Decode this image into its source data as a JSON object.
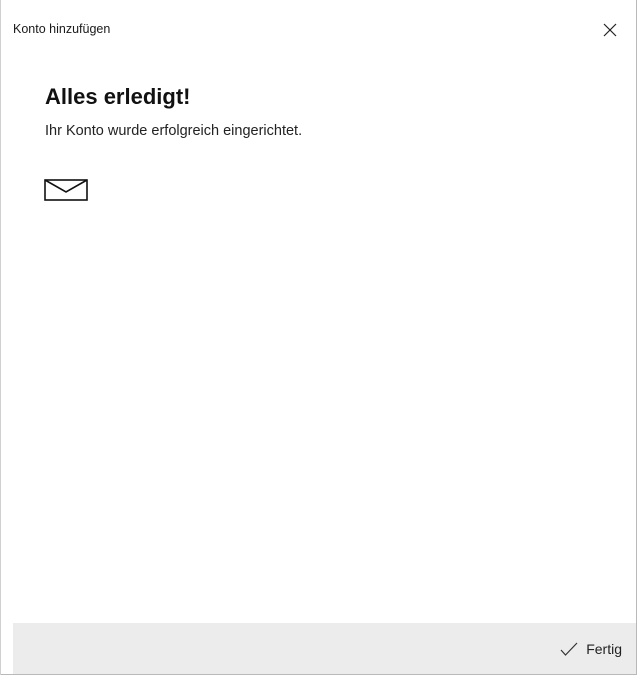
{
  "window": {
    "title": "Konto hinzufügen"
  },
  "main": {
    "heading": "Alles erledigt!",
    "message": "Ihr Konto wurde erfolgreich eingerichtet.",
    "icon": "mail-icon"
  },
  "footer": {
    "done_label": "Fertig",
    "done_icon": "checkmark-icon",
    "background_color": "#ececec"
  },
  "titlebar": {
    "close_icon": "close-icon"
  }
}
